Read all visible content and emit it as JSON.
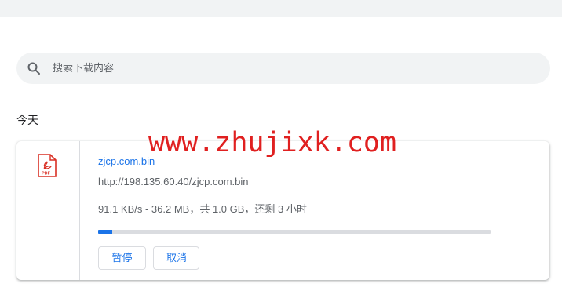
{
  "search": {
    "placeholder": "搜索下载内容",
    "icon": "search-icon"
  },
  "section": {
    "title": "今天"
  },
  "download": {
    "file_icon": "pdf-file-icon",
    "file_icon_text": "PDF",
    "file_name": "zjcp.com.bin",
    "url": "http://198.135.60.40/zjcp.com.bin",
    "status": "91.1 KB/s - 36.2 MB，共 1.0 GB，还剩 3 小时",
    "progress_fraction": 0.0354,
    "pause_label": "暂停",
    "cancel_label": "取消"
  },
  "watermark": {
    "text": "www.zhujixk.com"
  },
  "colors": {
    "accent": "#1a73e8",
    "watermark": "#e02020",
    "pdf_icon": "#d93025"
  }
}
